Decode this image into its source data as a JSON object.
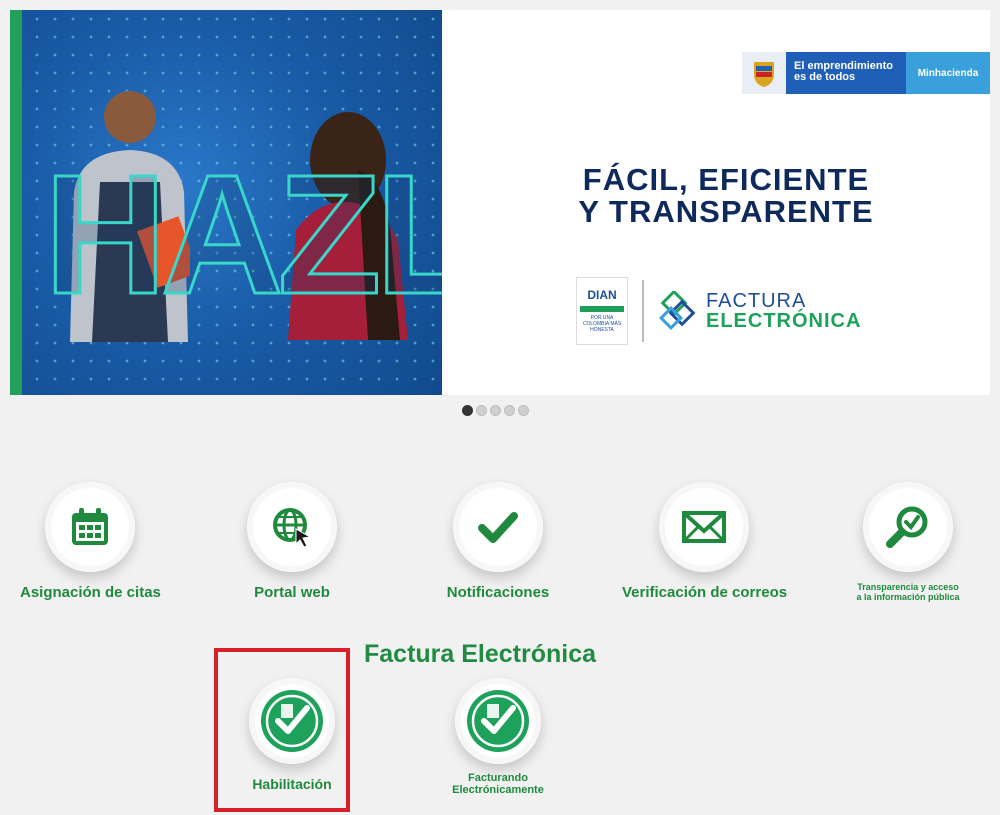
{
  "banner": {
    "overlay_word": "HAZLO",
    "gov_slogan_line1": "El emprendimiento",
    "gov_slogan_line2": "es de todos",
    "ministry": "Minhacienda",
    "headline_line1": "FÁCIL, EFICIENTE",
    "headline_line2": "Y TRANSPARENTE",
    "dian": "DIAN",
    "dian_tagline": "POR UNA COLOMBIA MÁS HONESTA",
    "fe_line1": "FACTURA",
    "fe_line2": "ELECTRÓNICA"
  },
  "carousel": {
    "count": 5,
    "active_index": 0
  },
  "services": [
    {
      "label": "Asignación de citas",
      "icon": "calendar-icon"
    },
    {
      "label": "Portal web",
      "icon": "globe-cursor-icon"
    },
    {
      "label": "Notificaciones",
      "icon": "checkmark-icon"
    },
    {
      "label": "Verificación de correos",
      "icon": "envelope-icon"
    },
    {
      "label_line1": "Transparencia y acceso",
      "label_line2": "a la información pública",
      "icon": "magnifier-check-icon"
    }
  ],
  "factura_section": {
    "title": "Factura Electrónica",
    "items": [
      {
        "label": "Habilitación",
        "icon": "factura-electronica-seal-icon"
      },
      {
        "label_line1": "Facturando",
        "label_line2": "Electrónicamente",
        "icon": "factura-electronica-seal-icon"
      }
    ]
  },
  "colors": {
    "accent_green": "#1f8a3e",
    "highlight_red": "#d6212a",
    "headline_navy": "#0e2a5c"
  }
}
